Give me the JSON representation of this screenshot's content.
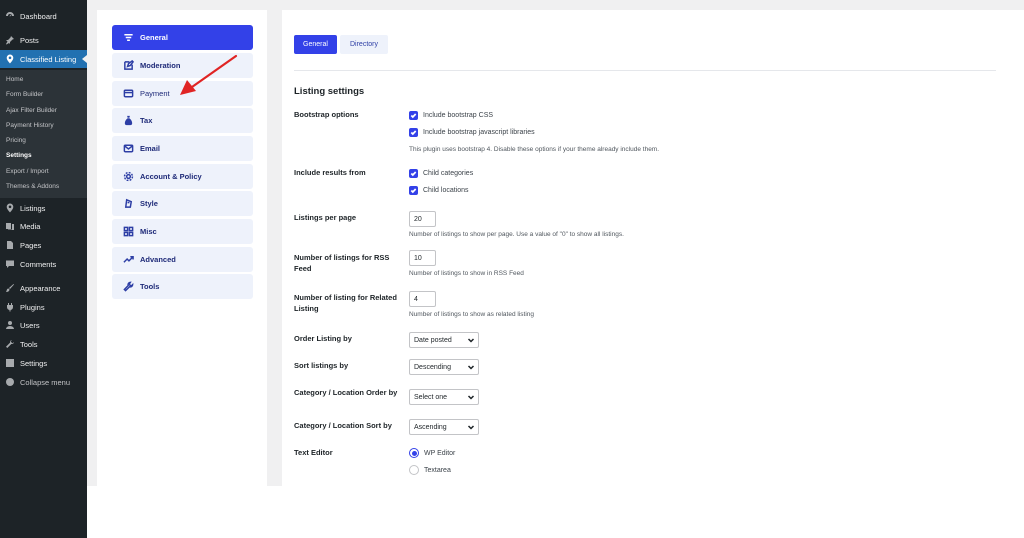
{
  "wp_menu": {
    "items_top": [
      {
        "label": "Dashboard",
        "icon": "dashboard-icon"
      },
      {
        "label": "Posts",
        "icon": "pin-icon"
      },
      {
        "label": "Classified Listing",
        "icon": "location-pin-icon"
      }
    ],
    "submenu": [
      "Home",
      "Form Builder",
      "Ajax Filter Builder",
      "Payment History",
      "Pricing",
      "Settings",
      "Export / Import",
      "Themes & Addons"
    ],
    "submenu_current": "Settings",
    "items_bottom": [
      {
        "label": "Listings",
        "icon": "location-pin-icon"
      },
      {
        "label": "Media",
        "icon": "media-icon"
      },
      {
        "label": "Pages",
        "icon": "pages-icon"
      },
      {
        "label": "Comments",
        "icon": "comment-icon"
      },
      {
        "label": "Appearance",
        "icon": "brush-icon"
      },
      {
        "label": "Plugins",
        "icon": "plugin-icon"
      },
      {
        "label": "Users",
        "icon": "users-icon"
      },
      {
        "label": "Tools",
        "icon": "wrench-icon"
      },
      {
        "label": "Settings",
        "icon": "settings-icon"
      },
      {
        "label": "Collapse menu",
        "icon": "collapse-icon"
      }
    ]
  },
  "settings_tabs": [
    {
      "label": "General",
      "icon": "filter-lines-icon"
    },
    {
      "label": "Moderation",
      "icon": "edit-icon"
    },
    {
      "label": "Payment",
      "icon": "card-icon"
    },
    {
      "label": "Tax",
      "icon": "tax-bag-icon"
    },
    {
      "label": "Email",
      "icon": "envelope-icon"
    },
    {
      "label": "Account & Policy",
      "icon": "gear-icon"
    },
    {
      "label": "Style",
      "icon": "style-icon"
    },
    {
      "label": "Misc",
      "icon": "grid-icon"
    },
    {
      "label": "Advanced",
      "icon": "trend-icon"
    },
    {
      "label": "Tools",
      "icon": "wrench-icon"
    }
  ],
  "active_settings_tab": "General",
  "sub_tabs": [
    "General",
    "Directory"
  ],
  "section_title": "Listing settings",
  "bootstrap": {
    "label": "Bootstrap options",
    "options": [
      "Include bootstrap CSS",
      "Include bootstrap javascript libraries"
    ],
    "hint": "This plugin uses bootstrap 4. Disable these options if your theme already include them."
  },
  "include_results": {
    "label": "Include results from",
    "options": [
      "Child categories",
      "Child locations"
    ]
  },
  "listings_per_page": {
    "label": "Listings per page",
    "value": "20",
    "hint": "Number of listings to show per page. Use a value of \"0\" to show all listings."
  },
  "rss_feed": {
    "label": "Number of listings for RSS Feed",
    "value": "10",
    "hint": "Number of listings to show in RSS Feed"
  },
  "related": {
    "label": "Number of listing for Related Listing",
    "value": "4",
    "hint": "Number of listings to show as related listing"
  },
  "order_by": {
    "label": "Order Listing by",
    "value": "Date posted"
  },
  "sort_by": {
    "label": "Sort listings by",
    "value": "Descending"
  },
  "cat_order": {
    "label": "Category / Location Order by",
    "value": "Select one"
  },
  "cat_sort": {
    "label": "Category / Location Sort by",
    "value": "Ascending"
  },
  "text_editor": {
    "label": "Text Editor",
    "options": [
      "WP Editor",
      "Textarea"
    ],
    "selected": "WP Editor"
  },
  "colors": {
    "accent": "#3341e8",
    "wp_sidebar": "#1d2327",
    "wp_active": "#2271b1",
    "annotation_arrow": "#e02424"
  }
}
